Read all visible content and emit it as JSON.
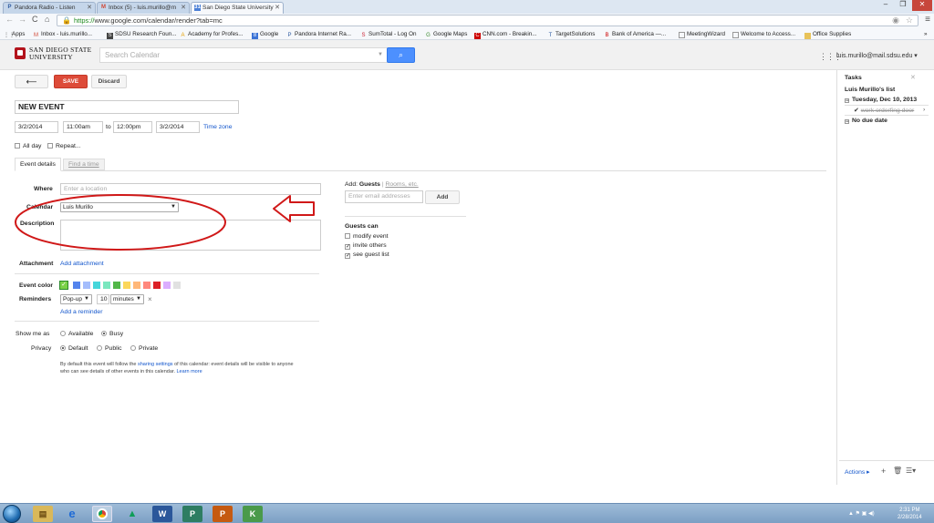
{
  "browser": {
    "tabs": [
      {
        "favicon": "P",
        "title": "Pandora Radio - Listen"
      },
      {
        "favicon": "M",
        "title": "Inbox (5) - luis.murillo@m"
      },
      {
        "favicon": "31",
        "title": "San Diego State University"
      }
    ],
    "url_scheme": "https://",
    "url_rest": "www.google.com/calendar/render?tab=mc",
    "apps_label": "Apps",
    "bookmarks": [
      {
        "icon": "M",
        "label": "Inbox - luis.murillo..."
      },
      {
        "icon": "S",
        "label": "SDSU Research Foun..."
      },
      {
        "icon": "A",
        "label": "Academy for Profes..."
      },
      {
        "icon": "8",
        "label": "Google"
      },
      {
        "icon": "P",
        "label": "Pandora Internet Ra..."
      },
      {
        "icon": "S",
        "label": "SumTotal - Log On"
      },
      {
        "icon": "G",
        "label": "Google Maps"
      },
      {
        "icon": "C",
        "label": "CNN.com - Breakin..."
      },
      {
        "icon": "T",
        "label": "TargetSolutions"
      },
      {
        "icon": "B",
        "label": "Bank of America —..."
      },
      {
        "icon": "D",
        "label": "MeetingWizard"
      },
      {
        "icon": "D",
        "label": "Welcome to Access..."
      },
      {
        "icon": "F",
        "label": "Office Supplies"
      }
    ],
    "more": "»"
  },
  "header": {
    "logo_line1": "SAN DIEGO STATE",
    "logo_line2": "UNIVERSITY",
    "search_placeholder": "Search Calendar",
    "account": "luis.murillo@mail.sdsu.edu"
  },
  "toolbar": {
    "back": "⟵",
    "save": "SAVE",
    "discard": "Discard"
  },
  "event": {
    "title": "NEW EVENT",
    "start_date": "3/2/2014",
    "start_time": "11:00am",
    "to": "to",
    "end_time": "12:00pm",
    "end_date": "3/2/2014",
    "timezone": "Time zone",
    "all_day": "All day",
    "repeat": "Repeat...",
    "tab_details": "Event details",
    "tab_find": "Find a time",
    "where_label": "Where",
    "where_placeholder": "Enter a location",
    "calendar_label": "Calendar",
    "calendar_value": "Luis Murillo",
    "description_label": "Description",
    "attachment_label": "Attachment",
    "attachment_link": "Add attachment",
    "color_label": "Event color",
    "colors": [
      "#7bd148",
      "#5484ed",
      "#a4bdfc",
      "#46d6db",
      "#7ae7bf",
      "#51b749",
      "#fbd75b",
      "#ffb878",
      "#ff887c",
      "#dc2127",
      "#dbadff",
      "#e1e1e1"
    ],
    "reminders_label": "Reminders",
    "reminder_type": "Pop-up",
    "reminder_value": "10",
    "reminder_unit": "minutes",
    "add_reminder": "Add a reminder",
    "show_me_as_label": "Show me as",
    "available": "Available",
    "busy": "Busy",
    "privacy_label": "Privacy",
    "default": "Default",
    "public": "Public",
    "private": "Private",
    "privacy_note_1": "By default this event will follow the",
    "privacy_note_link": "sharing settings",
    "privacy_note_2": "of this calendar: event details will be visible to anyone",
    "privacy_note_3": "who can see details of other events in this calendar.",
    "learn_more": "Learn more"
  },
  "guests": {
    "add_label": "Add:",
    "guests_tab": "Guests",
    "sep": "|",
    "rooms_tab": "Rooms, etc.",
    "email_placeholder": "Enter email addresses",
    "add_button": "Add",
    "can_label": "Guests can",
    "perm_modify": "modify event",
    "perm_invite": "invite others",
    "perm_see": "see guest list"
  },
  "tasks": {
    "title": "Tasks",
    "list_name": "Luis Murillo's list",
    "group1": "Tuesday, Dec 10, 2013",
    "task1": "work orderfing door",
    "group2": "No due date",
    "actions": "Actions ▸"
  },
  "taskbar": {
    "time": "2:31 PM",
    "date": "2/28/2014"
  }
}
